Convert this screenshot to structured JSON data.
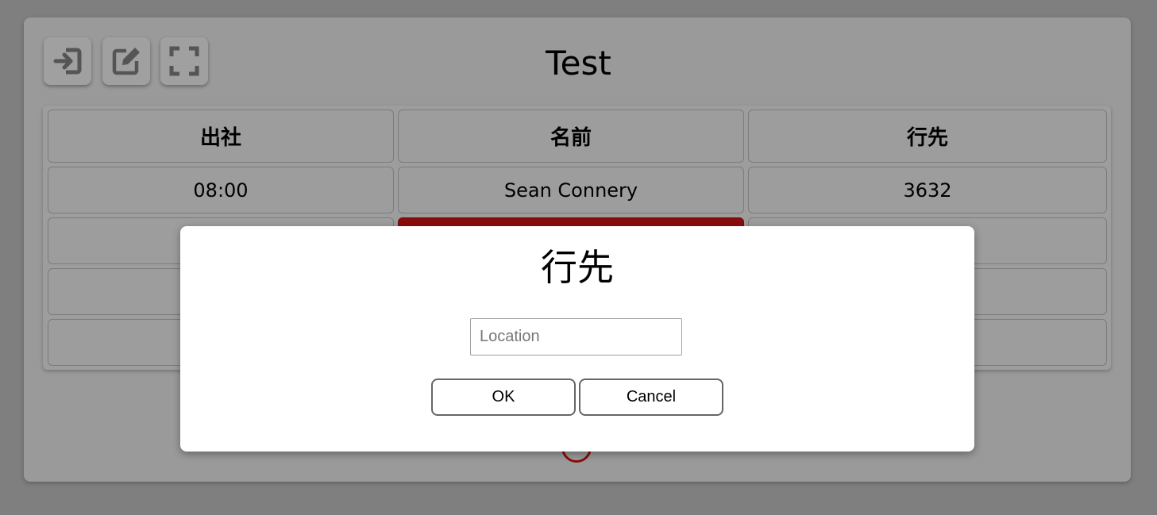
{
  "app": {
    "title": "Test"
  },
  "toolbar": {
    "icons": [
      "logout-icon",
      "edit-icon",
      "fullscreen-icon"
    ]
  },
  "table": {
    "headers": [
      "出社",
      "名前",
      "行先"
    ],
    "rows": [
      [
        "08:00",
        "Sean Connery",
        "3632"
      ],
      [
        "",
        "",
        ""
      ],
      [
        "",
        "",
        ""
      ],
      [
        "",
        "",
        ""
      ]
    ],
    "selected_row_color": "#8b0c0c"
  },
  "dialog": {
    "title": "行先",
    "input_placeholder": "Location",
    "input_value": "",
    "ok_label": "OK",
    "cancel_label": "Cancel"
  },
  "colors": {
    "backdrop": "#7f7f7f",
    "accent": "#8b0c0c"
  }
}
